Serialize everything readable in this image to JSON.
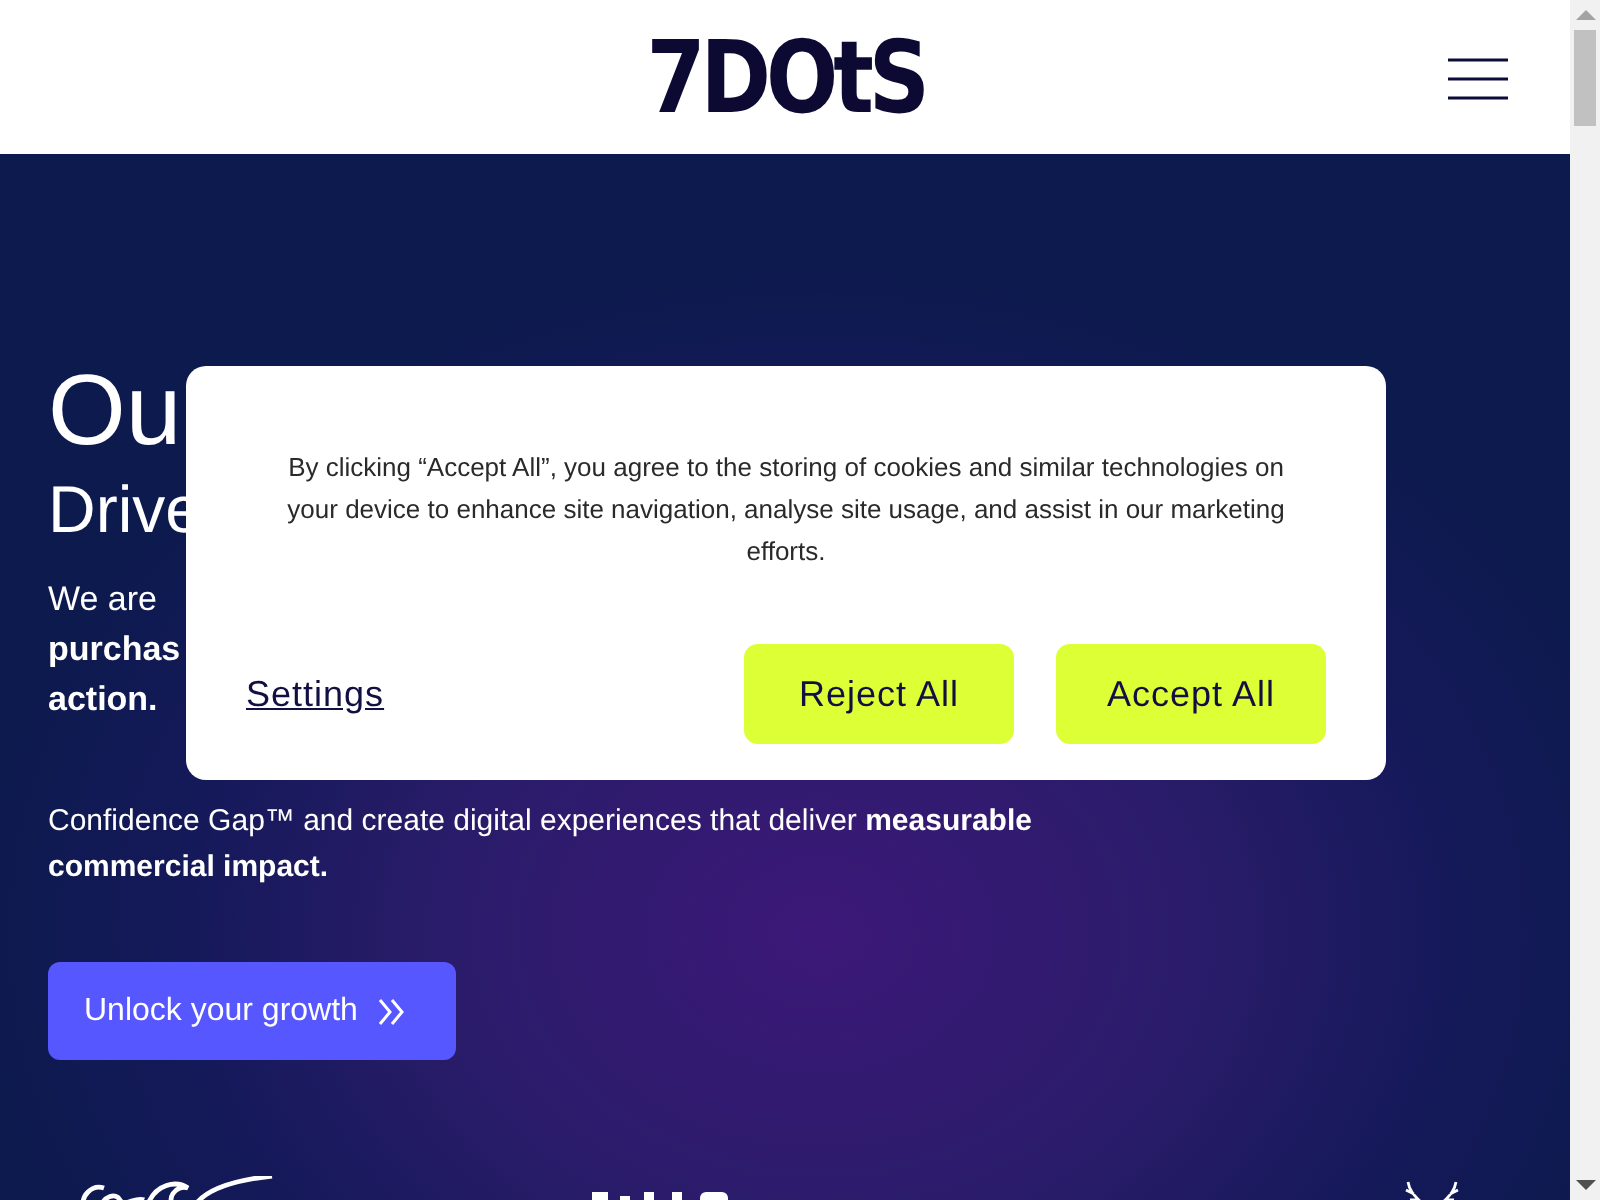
{
  "header": {
    "logo": "7DOtS"
  },
  "hero": {
    "heading": "Ou",
    "subheading": "Drive",
    "intro_lines": [
      "We are",
      "**purchas**",
      "**action.**"
    ],
    "paragraph": "Confidence Gap™ and create digital experiences that deliver **measurable commercial impact.**",
    "cta": "Unlock your growth"
  },
  "cookie_dialog": {
    "message": "By clicking “Accept All”, you agree to the storing of cookies and similar technologies on your device to enhance site navigation, analyse site usage, and assist in our marketing efforts.",
    "settings_link": "Settings",
    "buttons": [
      "Reject All",
      "Accept All"
    ]
  }
}
